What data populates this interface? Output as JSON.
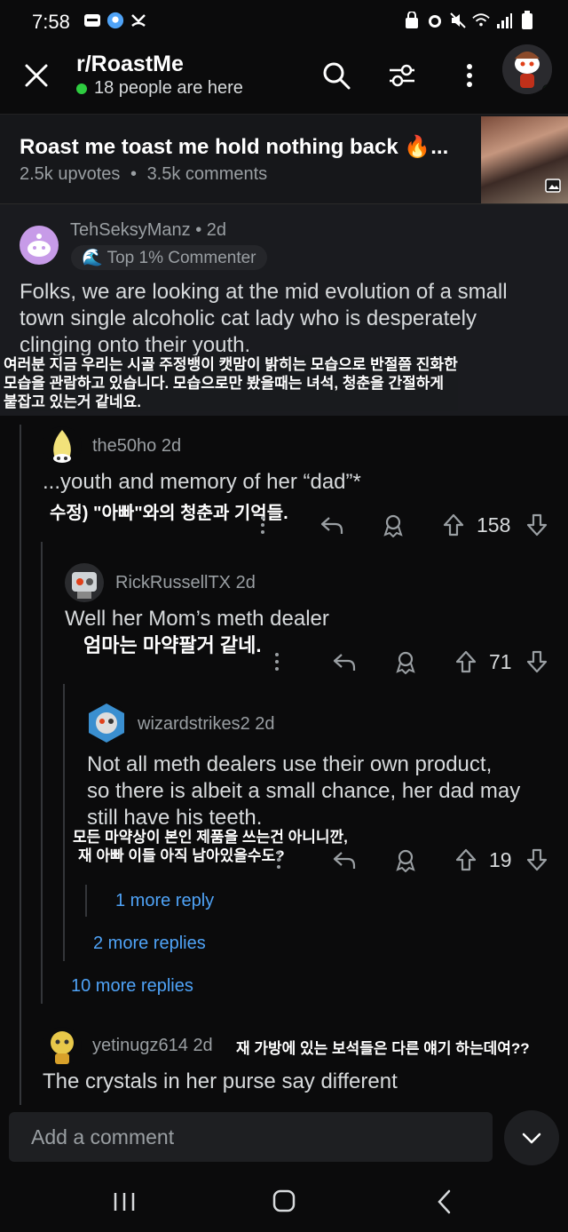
{
  "status_bar": {
    "time": "7:58"
  },
  "header": {
    "subreddit": "r/RoastMe",
    "online_text": "18 people are here"
  },
  "post": {
    "title": "Roast me toast me hold nothing back 🔥...",
    "upvotes": "2.5k upvotes",
    "separator": "•",
    "comments": "3.5k comments"
  },
  "comments": [
    {
      "username": "TehSeksyManz",
      "age": "• 2d",
      "badge": "🌊 Top 1% Commenter",
      "text_lines": [
        "Folks, we are looking at the mid evolution of a small",
        "town single alcoholic cat lady who is desperately",
        "clinging onto their youth."
      ],
      "translation_lines": [
        " 여러분 지금 우리는 시골 주정뱅이 캣맘이 밝히는 모습으로   반절쯤 진화한",
        "모습을 관람하고 있습니다. 모습으로만 봤을때는 녀석, 청춘을 간절하게",
        "붙잡고 있는거 같네요."
      ]
    },
    {
      "username": "the50ho",
      "age": "2d",
      "text_lines": [
        "...youth and memory of her “dad”*"
      ],
      "translation_lines": [
        "수정) \"아빠\"와의 청춘과 기억들."
      ],
      "votes": "158"
    },
    {
      "username": "RickRussellTX",
      "age": "2d",
      "text_lines": [
        "Well her Mom’s meth dealer"
      ],
      "translation_lines": [
        "엄마는 마약팔거 같네."
      ],
      "votes": "71"
    },
    {
      "username": "wizardstrikes2",
      "age": "2d",
      "text_lines": [
        "Not all meth dealers use their own product,",
        "so there is albeit a small chance, her dad may",
        "still have his teeth."
      ],
      "translation_lines": [
        "모든 마약상이 본인 제품을 쓰는건 아니니깐,",
        "재 아빠 이들 아직 남아있을수도?"
      ],
      "votes": "19"
    },
    {
      "username": "yetinugz614",
      "age": "2d",
      "text_lines": [
        "The crystals in her purse say different"
      ],
      "translation_lines": [
        "재 가방에 있는 보석들은 다른 얘기 하는데여??"
      ]
    }
  ],
  "more_links": {
    "one_more": "1 more reply",
    "two_more": "2 more replies",
    "ten_more": "10 more replies"
  },
  "composer": {
    "placeholder": "Add a comment"
  },
  "colors": {
    "online": "#2ecc40",
    "link": "#4fa3f7",
    "background": "#0b0b0c"
  }
}
